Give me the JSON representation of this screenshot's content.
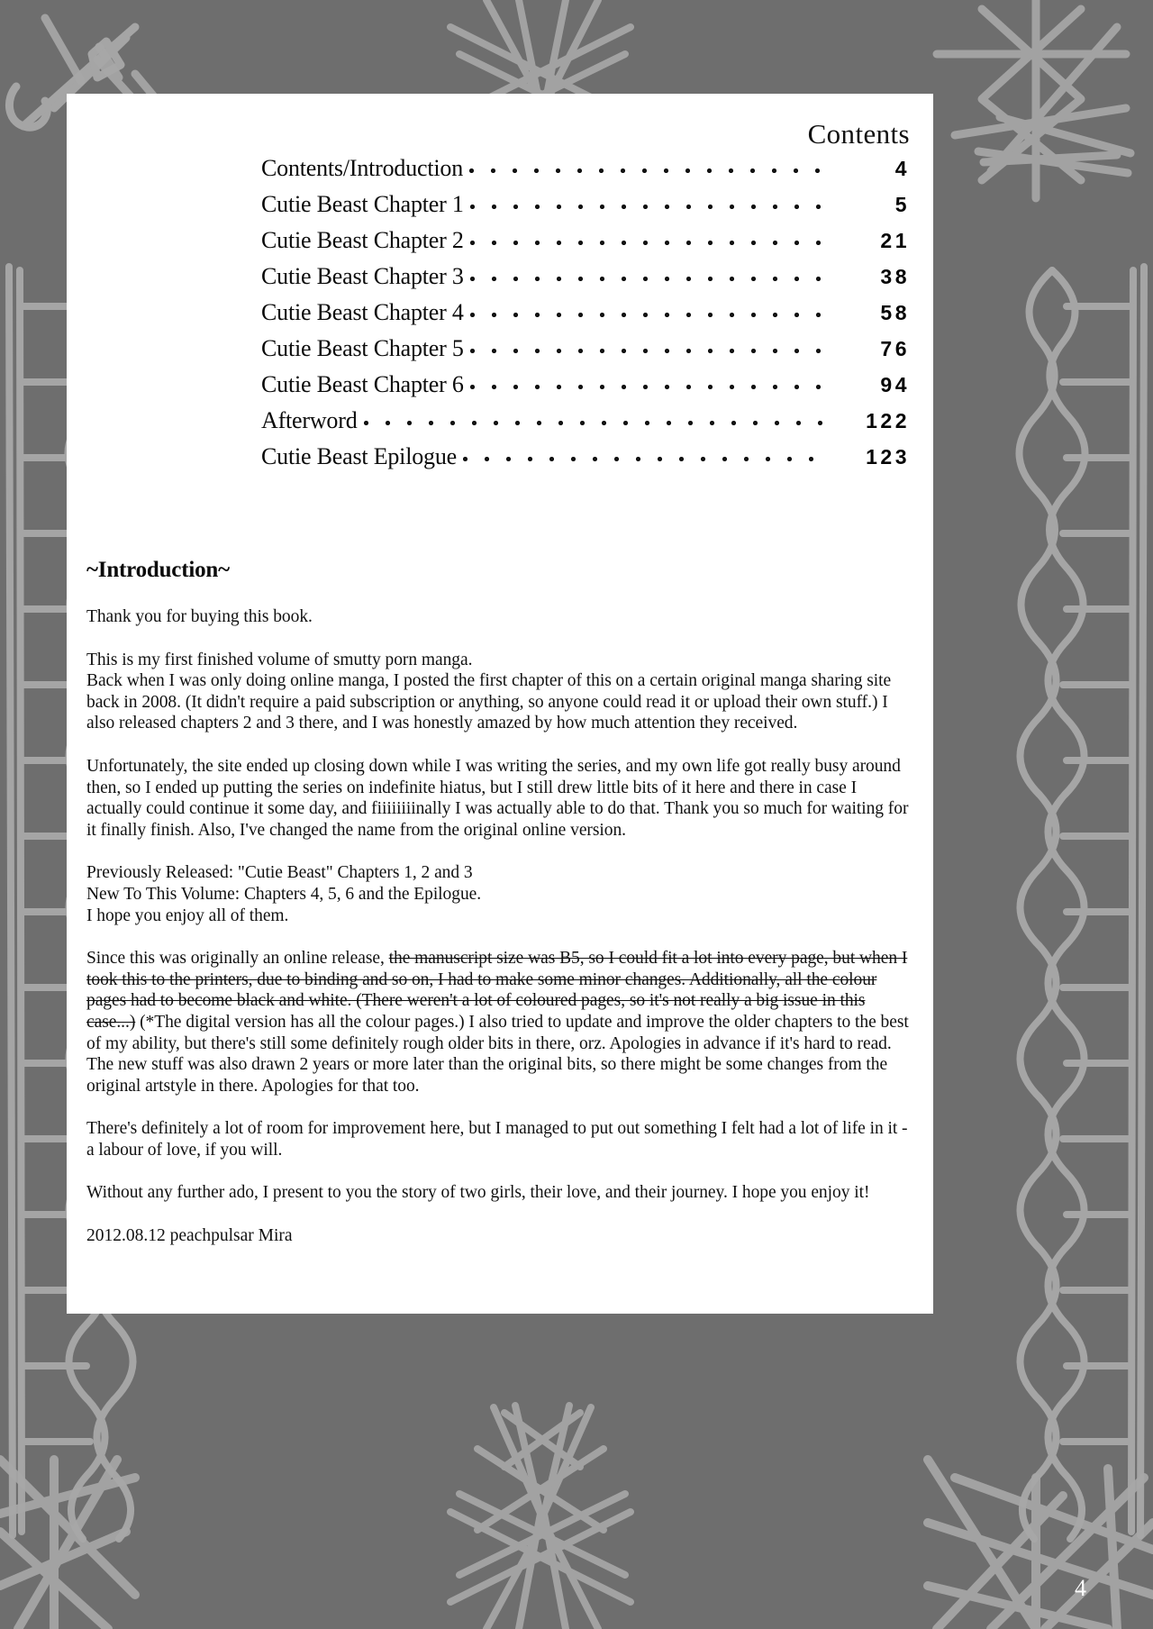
{
  "page": {
    "folio": "4",
    "background_color": "#6e6e6e",
    "ornament_color": "#a8a8a8",
    "sheet_color": "#ffffff",
    "text_color": "#111111"
  },
  "toc": {
    "title": "Contents",
    "entries": [
      {
        "label": "Contents/Introduction",
        "page": "4"
      },
      {
        "label": "Cutie Beast Chapter 1",
        "page": "5"
      },
      {
        "label": "Cutie Beast Chapter 2",
        "page": "21"
      },
      {
        "label": "Cutie Beast Chapter 3",
        "page": "38"
      },
      {
        "label": "Cutie Beast Chapter 4",
        "page": "58"
      },
      {
        "label": "Cutie Beast Chapter 5",
        "page": "76"
      },
      {
        "label": "Cutie Beast Chapter 6",
        "page": "94"
      },
      {
        "label": "Afterword",
        "page": "122"
      },
      {
        "label": "Cutie Beast Epilogue",
        "page": "123"
      }
    ]
  },
  "introduction": {
    "heading": "~Introduction~",
    "paragraphs": [
      "Thank you for buying this book.",
      "This is my first finished volume of smutty porn manga.\nBack when I was only doing online manga, I posted the first chapter of this on a certain original manga sharing site back in 2008. (It didn't require a paid subscription or anything, so anyone could read it  or upload their own stuff.) I also released chapters 2 and 3 there, and I was honestly amazed by how much attention they received.",
      "Unfortunately, the site ended up closing down while I was writing the series, and my own life got really busy around then, so I ended up putting the series on indefinite hiatus, but I still drew little bits of it here and there in case I actually could continue it some day, and fiiiiiiiinally I was actually able to do that. Thank you so much for waiting for it finally finish. Also, I've changed the name from the original online version.",
      "Previously Released: \"Cutie Beast\" Chapters 1, 2 and 3\nNew To This Volume: Chapters 4, 5, 6 and the Epilogue.\nI hope you enjoy all of them.",
      "There's definitely a lot of room for improvement here, but I managed to put out something I felt had a lot of life in it - a labour of love, if you will.",
      "Without any further ado, I present to you the story of two girls, their love, and their journey. I hope you enjoy it!"
    ],
    "manuscript_paragraph": {
      "lead_text": "Since this was originally an online release, ",
      "struck_text": "the manuscript size was B5, so I could fit a lot into every page, but when I took this to the printers, due to binding and so on, I had to make some minor changes. Additionally, all the colour pages had to become black and white. (There weren't a lot of coloured pages, so it's not really a big issue in this case...)",
      "tail_text": " (*The digital version has all the colour pages.) I also tried to update and improve the older chapters to the best of my ability, but there's still some definitely rough older bits in there, orz. Apologies in advance if it's hard to read. The new stuff was also drawn 2 years or more later than the original bits, so there might be some changes from the original artstyle in there. Apologies for that too."
    },
    "signature": "2012.08.12 peachpulsar Mira"
  }
}
